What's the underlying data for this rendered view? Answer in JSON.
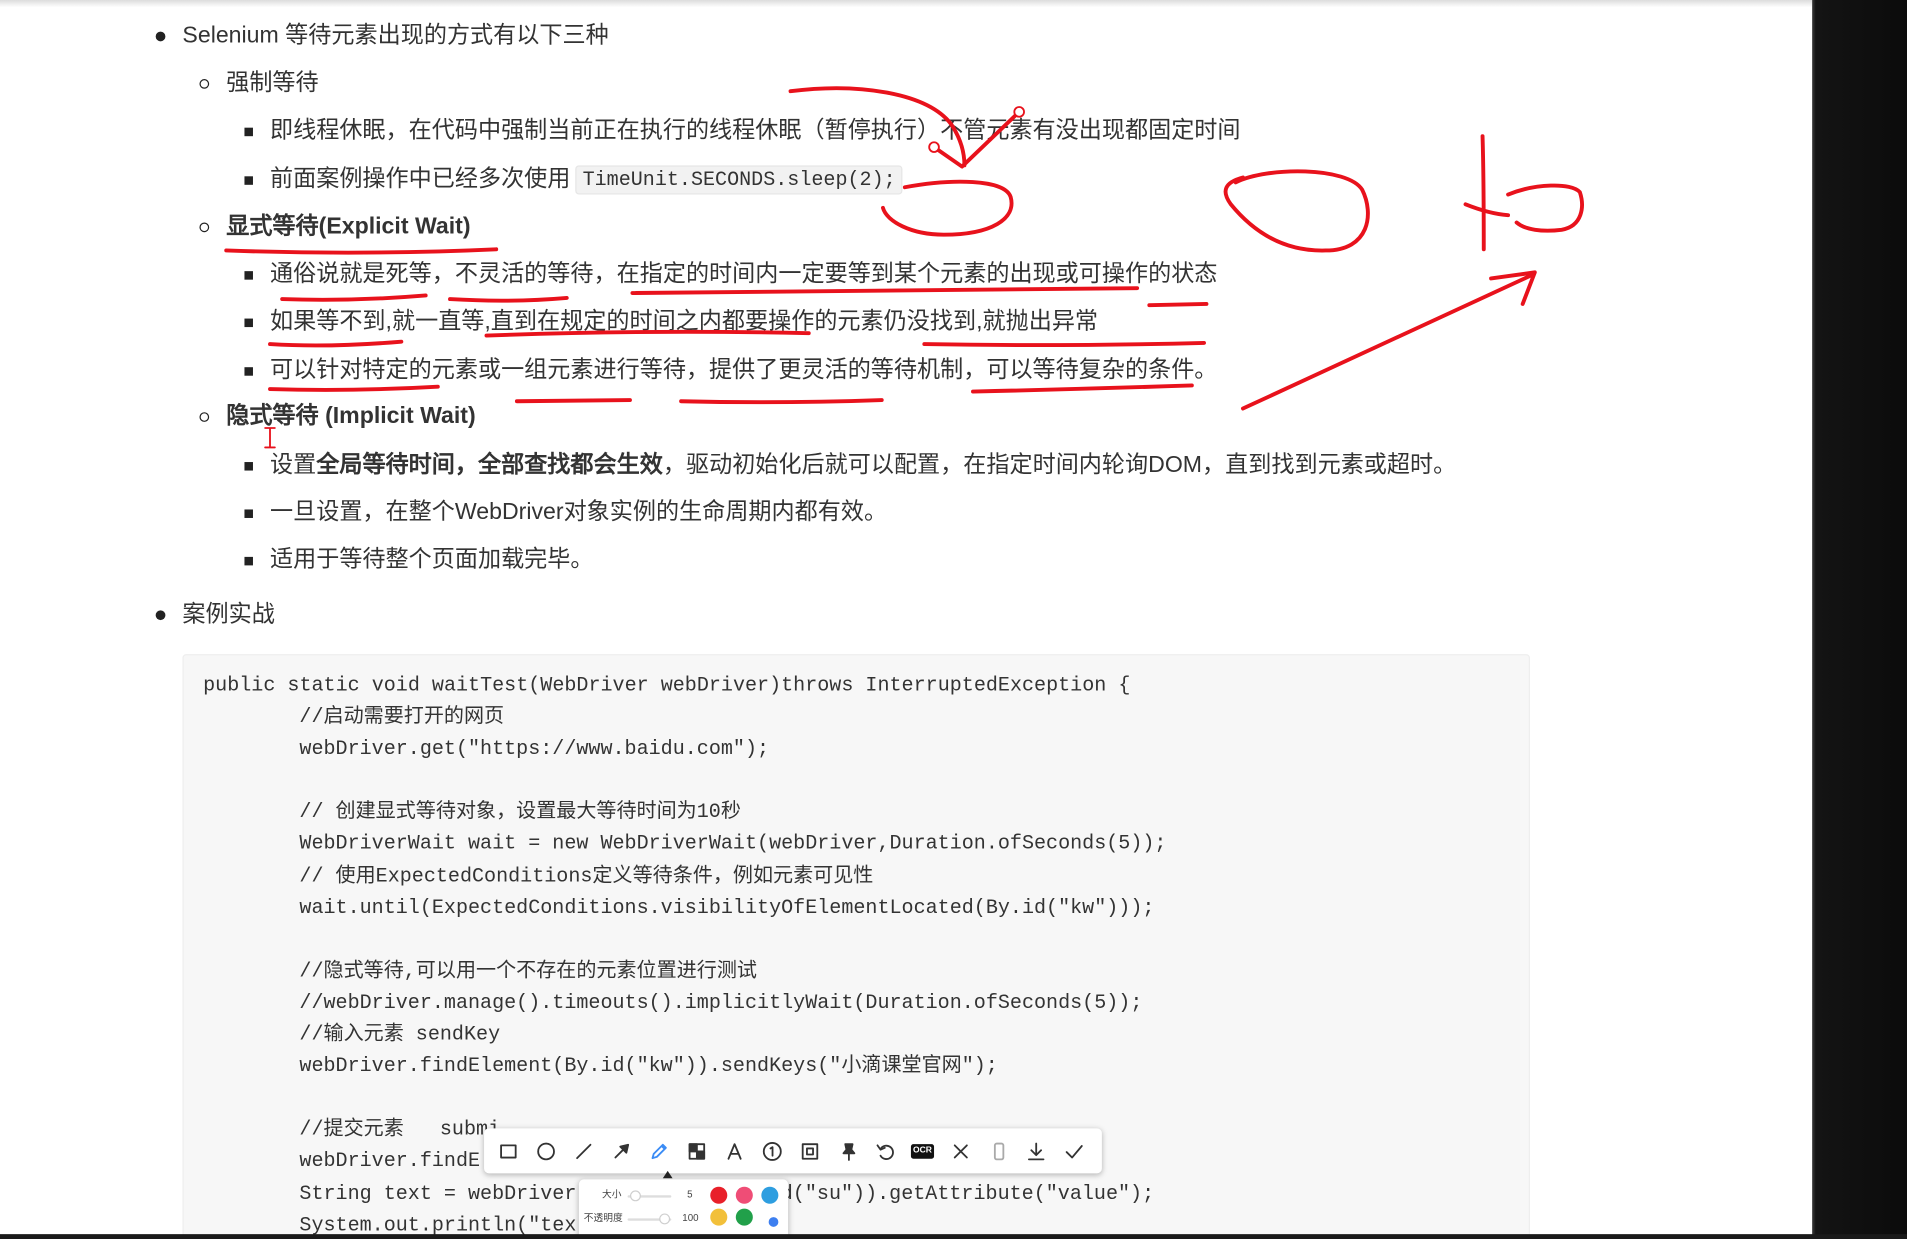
{
  "theme": {
    "text_color": "#333333",
    "annotation_color": "#e8121c",
    "active_tool_color": "#3b8cf5",
    "code_background": "#f7f7f7"
  },
  "outline": {
    "heading": "Selenium 等待元素出现的方式有以下三种",
    "forced_wait": {
      "title": "强制等待",
      "points": [
        "即线程休眠，在代码中强制当前正在执行的线程休眠（暂停执行）不管元素有没出现都固定时间",
        "前面案例操作中已经多次使用"
      ],
      "inline_code": "TimeUnit.SECONDS.sleep(2);"
    },
    "explicit_wait": {
      "title": "显式等待(Explicit Wait)",
      "points": [
        "通俗说就是死等，不灵活的等待，在指定的时间内一定要等到某个元素的出现或可操作的状态",
        "如果等不到,就一直等,直到在规定的时间之内都要操作的元素仍没找到,就抛出异常",
        "可以针对特定的元素或一组元素进行等待，提供了更灵活的等待机制，可以等待复杂的条件。"
      ]
    },
    "implicit_wait": {
      "title": "隐式等待 (Implicit Wait)",
      "first_point": {
        "before": "设置",
        "bold": "全局等待时间，全部查找都会生效",
        "after": "，驱动初始化后就可以配置，在指定时间内轮询DOM，直到找到元素或超时。"
      },
      "points": [
        "一旦设置，在整个WebDriver对象实例的生命周期内都有效。",
        "适用于等待整个页面加载完毕。"
      ]
    },
    "case_heading": "案例实战"
  },
  "code": {
    "lines": [
      "public static void waitTest(WebDriver webDriver)throws InterruptedException {",
      "//启动需要打开的网页",
      "webDriver.get(\"https://www.baidu.com\");",
      "",
      "// 创建显式等待对象，设置最大等待时间为10秒",
      "WebDriverWait wait = new WebDriverWait(webDriver,Duration.ofSeconds(5));",
      "// 使用ExpectedConditions定义等待条件，例如元素可见性",
      "wait.until(ExpectedConditions.visibilityOfElementLocated(By.id(\"kw\")));",
      "",
      "//隐式等待,可以用一个不存在的元素位置进行测试",
      "//webDriver.manage().timeouts().implicitlyWait(Duration.ofSeconds(5));",
      "//输入元素 sendKey",
      "webDriver.findElement(By.id(\"kw\")).sendKeys(\"小滴课堂官网\");",
      "",
      "//提交元素   submi",
      "webDriver.findE",
      "String text = webDriver",
      "System.out.println(\"tex"
    ],
    "occluded_line_tail": "d(\"su\")).getAttribute(\"value\");"
  },
  "toolbar": {
    "tools": [
      "rectangle-icon",
      "ellipse-icon",
      "line-icon",
      "arrow-icon",
      "pen-icon",
      "mosaic-icon",
      "text-icon",
      "serial-number-icon",
      "frame-icon",
      "pin-icon",
      "undo-icon",
      "ocr-icon",
      "close-icon",
      "device-icon",
      "download-icon",
      "check-icon"
    ],
    "active_tool": "pen-icon",
    "ocr_label": "OCR"
  },
  "pen_settings": {
    "size_label": "大小",
    "size_value": "5",
    "opacity_label": "不透明度",
    "opacity_value": "100",
    "colors": [
      "#e8202a",
      "#ef4d76",
      "#2e9ee0",
      "#f2c03a",
      "#21a04a",
      "#3d7ff0"
    ],
    "selected_color": "#e8202a"
  }
}
